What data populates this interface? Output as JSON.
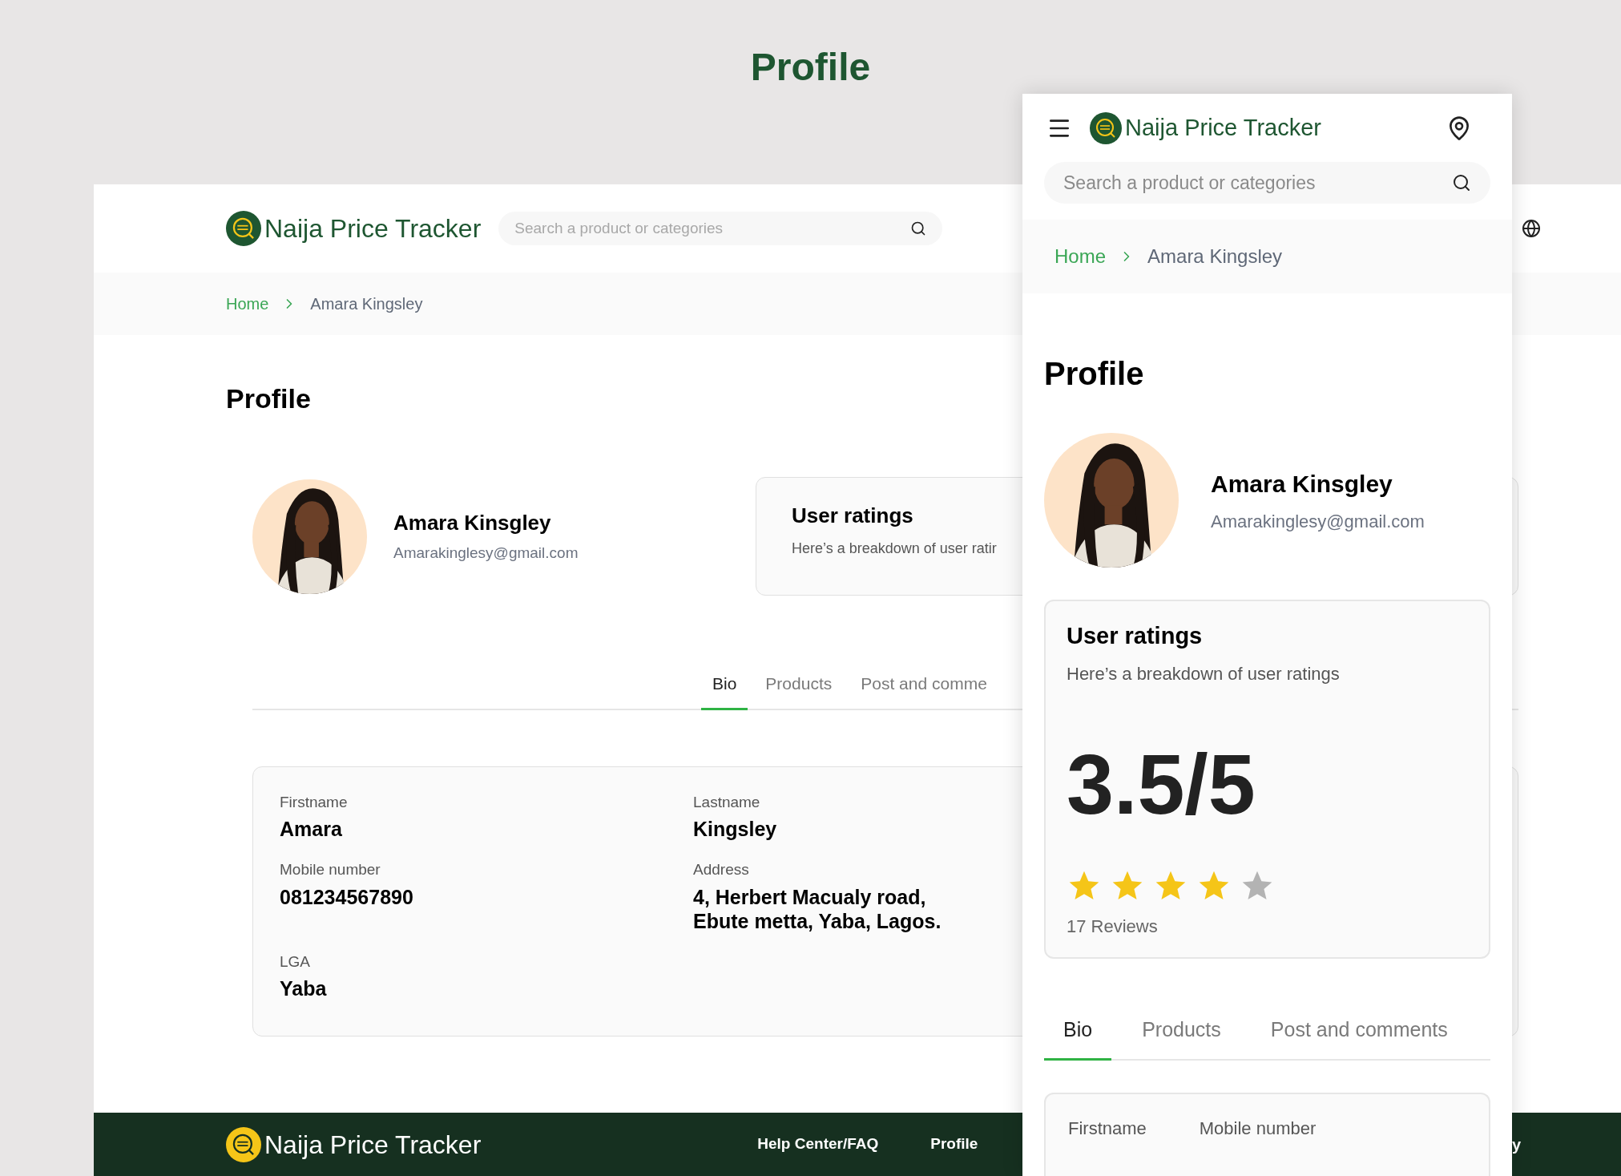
{
  "page_title": "Profile",
  "desktop": {
    "header": {
      "logo_text": "Naija Price Tracker",
      "search": {
        "placeholder": "Search a product or categories"
      }
    },
    "breadcrumb": [
      {
        "label": "Home",
        "current": false
      },
      {
        "label": "Amara Kingsley",
        "current": true
      }
    ],
    "heading": "Profile",
    "profile": {
      "name": "Amara Kinsgley",
      "email": "Amarakinglesy@gmail.com"
    },
    "ratings": {
      "title": "User ratings",
      "subtitle": "Here’s a breakdown of user ratir"
    },
    "tabs": [
      {
        "label": "Bio",
        "selected": true
      },
      {
        "label": "Products",
        "selected": false
      },
      {
        "label": "Post and comme",
        "selected": false
      }
    ],
    "details": [
      {
        "label": "Firstname",
        "value": "Amara"
      },
      {
        "label": "Lastname",
        "value": "Kingsley"
      },
      {
        "label": "Mobile number",
        "value": "081234567890"
      },
      {
        "label": "Address",
        "value": "4, Herbert Macualy road, Ebute metta, Yaba, Lagos."
      },
      {
        "label": "LGA",
        "value": "Yaba"
      }
    ],
    "footer": {
      "logo_text": "Naija Price Tracker",
      "links": [
        "Help Center/FAQ",
        "Profile"
      ],
      "cut_link": "y"
    }
  },
  "mobile": {
    "header": {
      "logo_text": "Naija Price Tracker",
      "search": {
        "placeholder": "Search a product or categories"
      }
    },
    "breadcrumb": [
      {
        "label": "Home",
        "current": false
      },
      {
        "label": "Amara Kingsley",
        "current": true
      }
    ],
    "heading": "Profile",
    "profile": {
      "name": "Amara Kinsgley",
      "email": "Amarakinglesy@gmail.com"
    },
    "ratings": {
      "title": "User ratings",
      "subtitle": "Here’s a breakdown of user ratings",
      "score": "3.5/5",
      "stars": 4,
      "reviews": "17 Reviews"
    },
    "tabs": [
      {
        "label": "Bio",
        "selected": true
      },
      {
        "label": "Products",
        "selected": false
      },
      {
        "label": "Post and comments",
        "selected": false
      }
    ],
    "details": [
      {
        "label": "Firstname"
      },
      {
        "label": "Mobile number"
      }
    ]
  }
}
